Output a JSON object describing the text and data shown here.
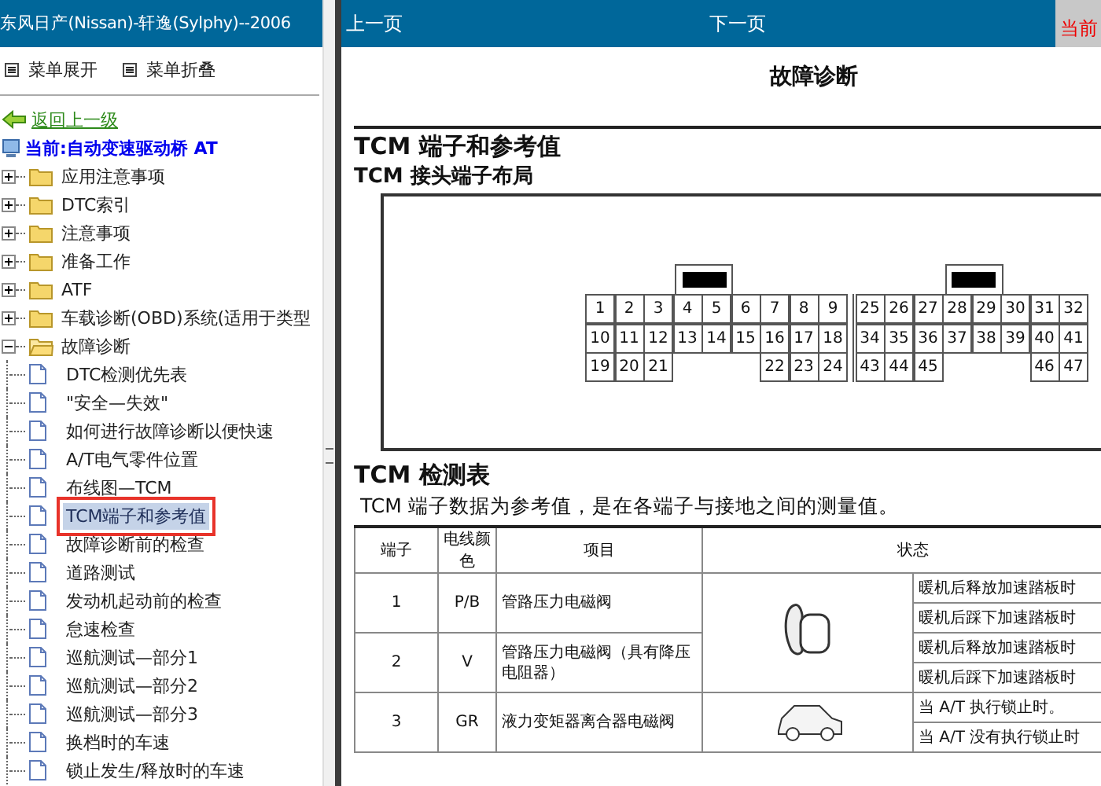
{
  "sidebar": {
    "title": "东风日产(Nissan)-轩逸(Sylphy)--2006",
    "menu": [
      {
        "label": "菜单展开"
      },
      {
        "label": "菜单折叠"
      }
    ],
    "back_link": "返回上一级",
    "current": "当前:自动变速驱动桥 AT",
    "tree": [
      {
        "label": "应用注意事项",
        "expanded": false
      },
      {
        "label": "DTC索引",
        "expanded": false
      },
      {
        "label": "注意事项",
        "expanded": false
      },
      {
        "label": "准备工作",
        "expanded": false
      },
      {
        "label": "ATF",
        "expanded": false
      },
      {
        "label": "车载诊断(OBD)系统(适用于类型",
        "expanded": false
      },
      {
        "label": "故障诊断",
        "expanded": true,
        "children": [
          {
            "label": "DTC检测优先表",
            "selected": false,
            "marked": false
          },
          {
            "label": "\"安全—失效\"",
            "selected": false,
            "marked": false
          },
          {
            "label": "如何进行故障诊断以便快速",
            "selected": false,
            "marked": false
          },
          {
            "label": "A/T电气零件位置",
            "selected": false,
            "marked": false
          },
          {
            "label": "布线图—TCM",
            "selected": false,
            "marked": false
          },
          {
            "label": "TCM端子和参考值",
            "selected": true,
            "marked": true
          },
          {
            "label": "故障诊断前的检查",
            "selected": false,
            "marked": false
          },
          {
            "label": "道路测试",
            "selected": false,
            "marked": false
          },
          {
            "label": "发动机起动前的检查",
            "selected": false,
            "marked": false
          },
          {
            "label": "怠速检查",
            "selected": false,
            "marked": false
          },
          {
            "label": "巡航测试—部分1",
            "selected": false,
            "marked": false
          },
          {
            "label": "巡航测试—部分2",
            "selected": false,
            "marked": false
          },
          {
            "label": "巡航测试—部分3",
            "selected": false,
            "marked": false
          },
          {
            "label": "换档时的车速",
            "selected": false,
            "marked": false
          },
          {
            "label": "锁止发生/释放时的车速",
            "selected": false,
            "marked": false
          }
        ]
      }
    ]
  },
  "toolbar": {
    "prev": "上一页",
    "next": "下一页",
    "current": "当前"
  },
  "document": {
    "title": "故障诊断",
    "heading": "TCM 端子和参考值",
    "subheading": "TCM 接头端子布局",
    "connector": {
      "left_rows": [
        [
          "1",
          "2",
          "3",
          "4",
          "5",
          "6",
          "7",
          "8",
          "9"
        ],
        [
          "10",
          "11",
          "12",
          "13",
          "14",
          "15",
          "16",
          "17",
          "18"
        ],
        [
          "19",
          "20",
          "21",
          null,
          null,
          null,
          "22",
          "23",
          "24"
        ]
      ],
      "right_rows": [
        [
          "25",
          "26",
          "27",
          "28",
          "29",
          "30",
          "31",
          "32"
        ],
        [
          "34",
          "35",
          "36",
          "37",
          "38",
          "39",
          "40",
          "41"
        ],
        [
          "43",
          "44",
          "45",
          null,
          null,
          null,
          "46",
          "47"
        ]
      ]
    },
    "table_heading": "TCM 检测表",
    "note": "TCM 端子数据为参考值，是在各端子与接地之间的测量值。",
    "table": {
      "columns": [
        "端子",
        "电线颜色",
        "项目",
        "状态"
      ],
      "groups": [
        {
          "kind": "key",
          "rows": [
            {
              "terminal": "1",
              "wire": "P/B",
              "item": "管路压力电磁阀",
              "states": [
                "暖机后释放加速踏板时",
                "暖机后踩下加速踏板时"
              ]
            },
            {
              "terminal": "2",
              "wire": "V",
              "item": "管路压力电磁阀（具有降压电阻器）",
              "states": [
                "暖机后释放加速踏板时",
                "暖机后踩下加速踏板时"
              ]
            }
          ]
        },
        {
          "kind": "car",
          "rows": [
            {
              "terminal": "3",
              "wire": "GR",
              "item": "液力变矩器离合器电磁阀",
              "states": [
                "当 A/T 执行锁止时。",
                "当 A/T 没有执行锁止时"
              ]
            }
          ]
        }
      ]
    }
  }
}
